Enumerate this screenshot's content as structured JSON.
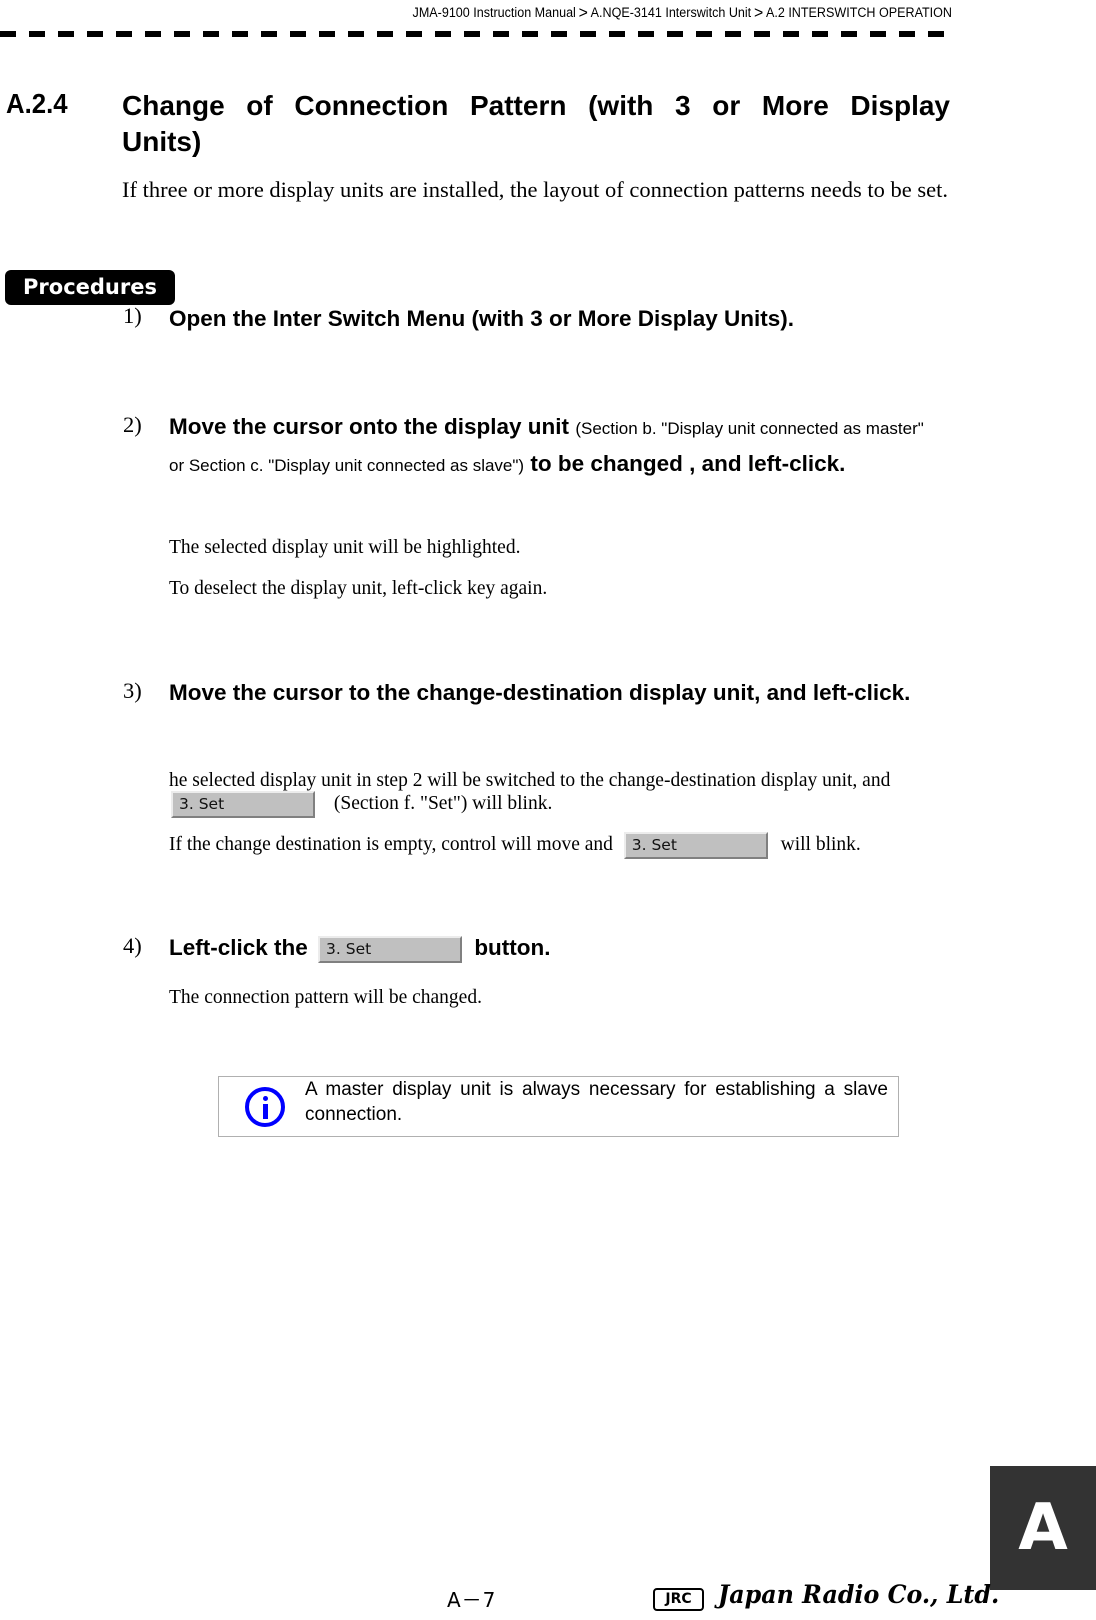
{
  "header": {
    "breadcrumb": [
      "JMA-9100 Instruction Manual",
      "A.NQE-3141 Interswitch Unit",
      "A.2  INTERSWITCH OPERATION"
    ],
    "separator": ">"
  },
  "section": {
    "number": "A.2.4",
    "title": "Change of Connection Pattern (with 3 or More Display Units)",
    "intro": "If three or more display units are installed, the layout of connection patterns needs to be set."
  },
  "procedures_label": "Procedures",
  "steps": [
    {
      "num": "1)",
      "title": "Open the Inter Switch Menu (with 3 or More Display Units)."
    },
    {
      "num": "2)",
      "title_a": "Move the cursor onto the display unit",
      "title_ref": "(Section b. \"Display unit connected as master\" or Section c. \"Display unit connected as slave\")",
      "title_b": "to be changed , and left-click.",
      "body": [
        "The selected display unit will be highlighted.",
        "To deselect the display unit, left-click key again."
      ]
    },
    {
      "num": "3)",
      "title": "Move the cursor to the change-destination display unit, and left-click.",
      "body1_a": "he selected display unit in step 2 will be switched to the change-destination display unit, and",
      "body1_b": "(Section f. \"Set\") will blink.",
      "body2_a": "If the change destination is empty, control will move and",
      "body2_b": "will blink."
    },
    {
      "num": "4)",
      "title_a": "Left-click the",
      "title_b": "button.",
      "body": "The connection pattern will be changed."
    }
  ],
  "set_button_label": "3. Set",
  "note": {
    "icon": "info-icon",
    "text": "A master display unit is always necessary for establishing a slave connection.",
    "icon_color": "#0000ff"
  },
  "chapter_tab": "A",
  "footer": {
    "page_number": "A－7",
    "logo_mark": "JRC",
    "company": "Japan Radio Co., Ltd."
  }
}
